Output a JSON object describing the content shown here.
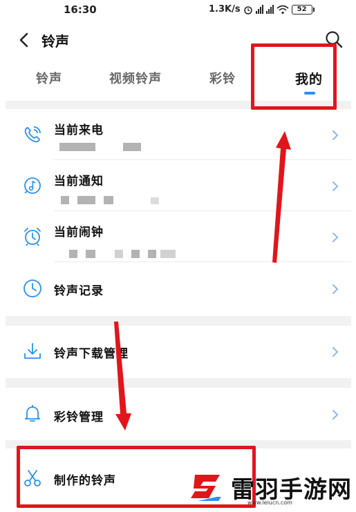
{
  "status_bar": {
    "time": "16:30",
    "net_speed": "1.3K/s",
    "battery": "52"
  },
  "header": {
    "title": "铃声"
  },
  "tabs": [
    {
      "label": "铃声"
    },
    {
      "label": "视频铃声"
    },
    {
      "label": "彩铃"
    },
    {
      "label": "我的"
    }
  ],
  "list": {
    "items": [
      {
        "title": "当前来电",
        "icon": "phone-ring-icon"
      },
      {
        "title": "当前通知",
        "icon": "music-note-icon"
      },
      {
        "title": "当前闹钟",
        "icon": "alarm-clock-icon"
      },
      {
        "title": "铃声记录",
        "icon": "clock-icon"
      },
      {
        "title": "铃声下载管理",
        "icon": "download-icon"
      },
      {
        "title": "彩铃管理",
        "icon": "bell-icon"
      },
      {
        "title": "制作的铃声",
        "icon": "scissors-icon"
      }
    ]
  },
  "watermark": {
    "text": "雷羽手游网",
    "url": "www.leiucn.com"
  },
  "colors": {
    "accent": "#2a8ff2",
    "highlight": "#e0161b",
    "icon": "#2a8ff2"
  }
}
